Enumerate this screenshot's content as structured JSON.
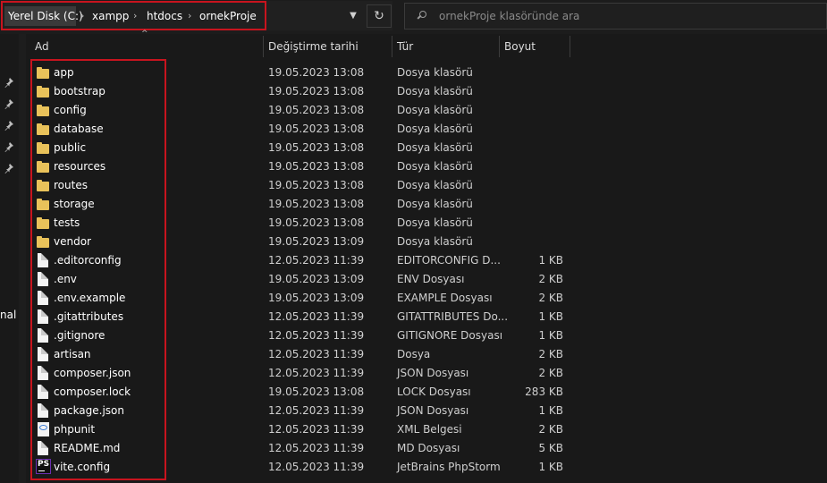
{
  "address_bar": {
    "crumbs": [
      "Yerel Disk (C:)",
      "xampp",
      "htdocs",
      "ornekProje"
    ],
    "search_placeholder": "ornekProje klasöründe ara"
  },
  "nav_pane": {
    "cut_label": "nal"
  },
  "columns": {
    "name": "Ad",
    "date": "Değiştirme tarihi",
    "type": "Tür",
    "size": "Boyut"
  },
  "files": [
    {
      "name": "app",
      "date": "19.05.2023 13:08",
      "type": "Dosya klasörü",
      "size": "",
      "icon": "folder-icon"
    },
    {
      "name": "bootstrap",
      "date": "19.05.2023 13:08",
      "type": "Dosya klasörü",
      "size": "",
      "icon": "folder-icon"
    },
    {
      "name": "config",
      "date": "19.05.2023 13:08",
      "type": "Dosya klasörü",
      "size": "",
      "icon": "folder-icon"
    },
    {
      "name": "database",
      "date": "19.05.2023 13:08",
      "type": "Dosya klasörü",
      "size": "",
      "icon": "folder-icon"
    },
    {
      "name": "public",
      "date": "19.05.2023 13:08",
      "type": "Dosya klasörü",
      "size": "",
      "icon": "folder-icon"
    },
    {
      "name": "resources",
      "date": "19.05.2023 13:08",
      "type": "Dosya klasörü",
      "size": "",
      "icon": "folder-icon"
    },
    {
      "name": "routes",
      "date": "19.05.2023 13:08",
      "type": "Dosya klasörü",
      "size": "",
      "icon": "folder-icon"
    },
    {
      "name": "storage",
      "date": "19.05.2023 13:08",
      "type": "Dosya klasörü",
      "size": "",
      "icon": "folder-icon"
    },
    {
      "name": "tests",
      "date": "19.05.2023 13:08",
      "type": "Dosya klasörü",
      "size": "",
      "icon": "folder-icon"
    },
    {
      "name": "vendor",
      "date": "19.05.2023 13:09",
      "type": "Dosya klasörü",
      "size": "",
      "icon": "folder-icon"
    },
    {
      "name": ".editorconfig",
      "date": "12.05.2023 11:39",
      "type": "EDITORCONFIG D...",
      "size": "1 KB",
      "icon": "file-icon"
    },
    {
      "name": ".env",
      "date": "19.05.2023 13:09",
      "type": "ENV Dosyası",
      "size": "2 KB",
      "icon": "file-icon"
    },
    {
      "name": ".env.example",
      "date": "19.05.2023 13:09",
      "type": "EXAMPLE Dosyası",
      "size": "2 KB",
      "icon": "file-icon"
    },
    {
      "name": ".gitattributes",
      "date": "12.05.2023 11:39",
      "type": "GITATTRIBUTES Do...",
      "size": "1 KB",
      "icon": "file-icon"
    },
    {
      "name": ".gitignore",
      "date": "12.05.2023 11:39",
      "type": "GITIGNORE Dosyası",
      "size": "1 KB",
      "icon": "file-icon"
    },
    {
      "name": "artisan",
      "date": "12.05.2023 11:39",
      "type": "Dosya",
      "size": "2 KB",
      "icon": "file-icon"
    },
    {
      "name": "composer.json",
      "date": "12.05.2023 11:39",
      "type": "JSON Dosyası",
      "size": "2 KB",
      "icon": "file-icon"
    },
    {
      "name": "composer.lock",
      "date": "19.05.2023 13:08",
      "type": "LOCK Dosyası",
      "size": "283 KB",
      "icon": "file-icon"
    },
    {
      "name": "package.json",
      "date": "12.05.2023 11:39",
      "type": "JSON Dosyası",
      "size": "1 KB",
      "icon": "file-icon"
    },
    {
      "name": "phpunit",
      "date": "12.05.2023 11:39",
      "type": "XML Belgesi",
      "size": "2 KB",
      "icon": "xml-file-icon"
    },
    {
      "name": "README.md",
      "date": "12.05.2023 11:39",
      "type": "MD Dosyası",
      "size": "5 KB",
      "icon": "file-icon"
    },
    {
      "name": "vite.config",
      "date": "12.05.2023 11:39",
      "type": "JetBrains PhpStorm",
      "size": "1 KB",
      "icon": "phpstorm-file-icon"
    }
  ],
  "colors": {
    "highlight_box": "#c8141e",
    "folder": "#e9c25a",
    "background": "#191919"
  }
}
